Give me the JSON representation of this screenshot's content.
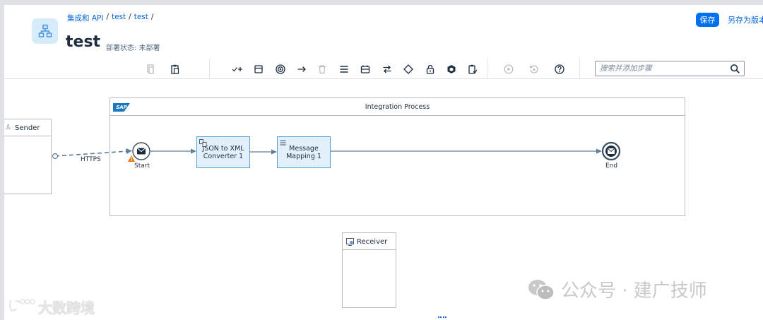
{
  "header": {
    "breadcrumb": [
      "集成和 API",
      "test",
      "test"
    ],
    "breadcrumb_sep": "/",
    "title": "test",
    "deploy_status": "部署状态: 未部署",
    "save_label": "保存",
    "save_version_label": "另存为版本"
  },
  "toolbar": {
    "icons": [
      "copy-icon",
      "paste-icon",
      "add-participant-icon",
      "process-icon",
      "event-icon",
      "connector-icon",
      "delete-icon",
      "menu-icon",
      "call-icon",
      "mapping-icon",
      "gateway-icon",
      "security-icon",
      "transform-icon",
      "validate-icon",
      "run-icon",
      "reset-icon",
      "help-icon"
    ],
    "search_placeholder": "搜索并添加步骤"
  },
  "canvas": {
    "sender_label": "Sender",
    "receiver_label": "Receiver",
    "process_title": "Integration Process",
    "sap_logo": "SAP",
    "start_label": "Start",
    "end_label": "End",
    "steps": [
      {
        "line1": "JSON to XML",
        "line2": "Converter 1"
      },
      {
        "line1": "Message",
        "line2": "Mapping 1"
      }
    ],
    "https_label": "HTTPS"
  },
  "watermark": {
    "text1": "公众号 · 建广技师",
    "text2": "大数跨境"
  },
  "colors": {
    "accent": "#0070f2",
    "step_fill": "#e2f0fb",
    "step_border": "#5c9fd1",
    "flow_line": "#5b7d9c"
  }
}
